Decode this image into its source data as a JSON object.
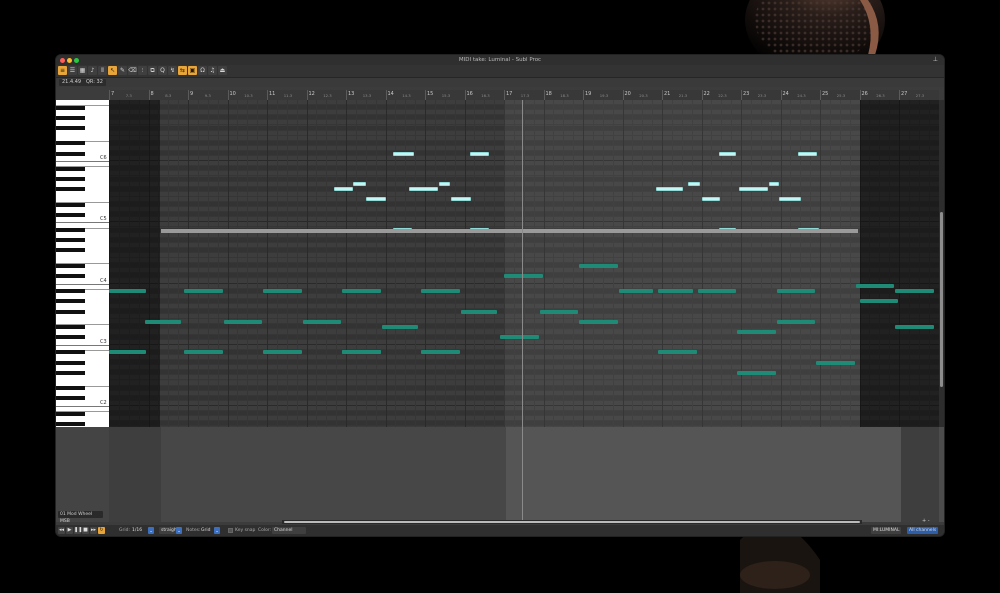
{
  "window": {
    "title": "MIDI take: Luminal - Subl Proc"
  },
  "info": {
    "position": "21.4.49",
    "grid_display": "QR: 32"
  },
  "ruler": {
    "bars": [
      {
        "bar": "7",
        "half": "7.3"
      },
      {
        "bar": "8",
        "half": "8.3"
      },
      {
        "bar": "9",
        "half": "9.3"
      },
      {
        "bar": "10",
        "half": "10.3"
      },
      {
        "bar": "11",
        "half": "11.3"
      },
      {
        "bar": "12",
        "half": "12.3"
      },
      {
        "bar": "13",
        "half": "13.3"
      },
      {
        "bar": "14",
        "half": "14.3"
      },
      {
        "bar": "15",
        "half": "15.3"
      },
      {
        "bar": "16",
        "half": "16.3"
      },
      {
        "bar": "17",
        "half": "17.3"
      },
      {
        "bar": "18",
        "half": "18.3"
      },
      {
        "bar": "19",
        "half": "19.3"
      },
      {
        "bar": "20",
        "half": "20.3"
      },
      {
        "bar": "21",
        "half": "21.3"
      },
      {
        "bar": "22",
        "half": "22.3"
      },
      {
        "bar": "23",
        "half": "23.3"
      },
      {
        "bar": "24",
        "half": "24.3"
      },
      {
        "bar": "25",
        "half": "25.3"
      },
      {
        "bar": "26",
        "half": "26.3"
      },
      {
        "bar": "27",
        "half": "27.3"
      }
    ]
  },
  "keyboard": {
    "octave_labels": [
      "C6",
      "C5",
      "C4",
      "C3",
      "C2",
      "C1"
    ]
  },
  "notes": [
    {
      "bar": 14,
      "beat": 0.2,
      "len": 0.55,
      "row": 10,
      "vel": "hi"
    },
    {
      "bar": 16,
      "beat": 0.15,
      "len": 0.5,
      "row": 10,
      "vel": "hi"
    },
    {
      "bar": 12.7,
      "beat": 0,
      "len": 0.5,
      "row": 17,
      "vel": "hi"
    },
    {
      "bar": 13.18,
      "beat": 0,
      "len": 0.35,
      "row": 16,
      "vel": "hi"
    },
    {
      "bar": 13.5,
      "beat": 0,
      "len": 0.55,
      "row": 19,
      "vel": "hi"
    },
    {
      "bar": 14.6,
      "beat": 0,
      "len": 0.75,
      "row": 17,
      "vel": "hi"
    },
    {
      "bar": 15.35,
      "beat": 0,
      "len": 0.3,
      "row": 16,
      "vel": "hi"
    },
    {
      "bar": 15.65,
      "beat": 0,
      "len": 0.55,
      "row": 19,
      "vel": "hi"
    },
    {
      "bar": 14.2,
      "beat": 0,
      "len": 0.5,
      "row": 25,
      "vel": "hi"
    },
    {
      "bar": 16.15,
      "beat": 0,
      "len": 0.5,
      "row": 25,
      "vel": "hi"
    },
    {
      "bar": 22.45,
      "beat": 0,
      "len": 0.45,
      "row": 10,
      "vel": "hi"
    },
    {
      "bar": 24.45,
      "beat": 0,
      "len": 0.5,
      "row": 10,
      "vel": "hi"
    },
    {
      "bar": 20.85,
      "beat": 0,
      "len": 0.7,
      "row": 17,
      "vel": "hi"
    },
    {
      "bar": 21.65,
      "beat": 0,
      "len": 0.35,
      "row": 16,
      "vel": "hi"
    },
    {
      "bar": 22,
      "beat": 0,
      "len": 0.5,
      "row": 19,
      "vel": "hi"
    },
    {
      "bar": 22.95,
      "beat": 0,
      "len": 0.75,
      "row": 17,
      "vel": "hi"
    },
    {
      "bar": 23.7,
      "beat": 0,
      "len": 0.3,
      "row": 16,
      "vel": "hi"
    },
    {
      "bar": 23.95,
      "beat": 0,
      "len": 0.6,
      "row": 19,
      "vel": "hi"
    },
    {
      "bar": 22.45,
      "beat": 0,
      "len": 0.45,
      "row": 25,
      "vel": "hi"
    },
    {
      "bar": 24.45,
      "beat": 0,
      "len": 0.55,
      "row": 25,
      "vel": "hi"
    },
    {
      "bar": 7,
      "beat": 0,
      "len": 0.95,
      "row": 37,
      "vel": "lo"
    },
    {
      "bar": 8.9,
      "beat": 0,
      "len": 1,
      "row": 37,
      "vel": "lo"
    },
    {
      "bar": 10.9,
      "beat": 0,
      "len": 1,
      "row": 37,
      "vel": "lo"
    },
    {
      "bar": 12.9,
      "beat": 0,
      "len": 1,
      "row": 37,
      "vel": "lo"
    },
    {
      "bar": 14.9,
      "beat": 0,
      "len": 1,
      "row": 37,
      "vel": "lo"
    },
    {
      "bar": 20.9,
      "beat": 0,
      "len": 0.9,
      "row": 37,
      "vel": "lo"
    },
    {
      "bar": 21.9,
      "beat": 0,
      "len": 1,
      "row": 37,
      "vel": "lo"
    },
    {
      "bar": 23.9,
      "beat": 0,
      "len": 1,
      "row": 37,
      "vel": "lo"
    },
    {
      "bar": 25.9,
      "beat": 0,
      "len": 1,
      "row": 36,
      "vel": "lo"
    },
    {
      "bar": 26.9,
      "beat": 0,
      "len": 1,
      "row": 37,
      "vel": "lo"
    },
    {
      "bar": 7.9,
      "beat": 0,
      "len": 0.95,
      "row": 43,
      "vel": "lo"
    },
    {
      "bar": 9.9,
      "beat": 0,
      "len": 1,
      "row": 43,
      "vel": "lo"
    },
    {
      "bar": 11.9,
      "beat": 0,
      "len": 1,
      "row": 43,
      "vel": "lo"
    },
    {
      "bar": 13.9,
      "beat": 0,
      "len": 0.95,
      "row": 44,
      "vel": "lo"
    },
    {
      "bar": 15.9,
      "beat": 0,
      "len": 0.95,
      "row": 41,
      "vel": "lo"
    },
    {
      "bar": 17.9,
      "beat": 0,
      "len": 1,
      "row": 41,
      "vel": "lo"
    },
    {
      "bar": 18.9,
      "beat": 0,
      "len": 1,
      "row": 43,
      "vel": "lo"
    },
    {
      "bar": 22.9,
      "beat": 0,
      "len": 1,
      "row": 45,
      "vel": "lo"
    },
    {
      "bar": 23.9,
      "beat": 0,
      "len": 1,
      "row": 43,
      "vel": "lo"
    },
    {
      "bar": 26,
      "beat": 0,
      "len": 1,
      "row": 39,
      "vel": "lo"
    },
    {
      "bar": 26.9,
      "beat": 0,
      "len": 1,
      "row": 44,
      "vel": "lo"
    },
    {
      "bar": 17,
      "beat": 0,
      "len": 1,
      "row": 34,
      "vel": "lo"
    },
    {
      "bar": 18.9,
      "beat": 0,
      "len": 1,
      "row": 32,
      "vel": "lo"
    },
    {
      "bar": 19.9,
      "beat": 0,
      "len": 0.9,
      "row": 37,
      "vel": "lo"
    },
    {
      "bar": 7,
      "beat": 0,
      "len": 0.95,
      "row": 49,
      "vel": "lo"
    },
    {
      "bar": 8.9,
      "beat": 0,
      "len": 1,
      "row": 49,
      "vel": "lo"
    },
    {
      "bar": 10.9,
      "beat": 0,
      "len": 1,
      "row": 49,
      "vel": "lo"
    },
    {
      "bar": 12.9,
      "beat": 0,
      "len": 1,
      "row": 49,
      "vel": "lo"
    },
    {
      "bar": 14.9,
      "beat": 0,
      "len": 1,
      "row": 49,
      "vel": "lo"
    },
    {
      "bar": 16.9,
      "beat": 0,
      "len": 1,
      "row": 46,
      "vel": "lo"
    },
    {
      "bar": 20.9,
      "beat": 0,
      "len": 1,
      "row": 49,
      "vel": "lo"
    },
    {
      "bar": 22.9,
      "beat": 0,
      "len": 1,
      "row": 53,
      "vel": "lo"
    },
    {
      "bar": 24.9,
      "beat": 0,
      "len": 1,
      "row": 51,
      "vel": "lo"
    },
    {
      "bar": 12.9,
      "beat": 0,
      "len": 1,
      "row": 49,
      "vel": "lo"
    }
  ],
  "lane": {
    "cc_selector": "01 Mod Wheel MSB"
  },
  "bottom": {
    "grid_label": "Grid:",
    "grid_value": "1/16",
    "grid_mode": "straight",
    "notes_label": "Notes:",
    "notes_value": "Grid",
    "keysnap_label": "Key snap",
    "color_label": "Color:",
    "color_value": "Channel",
    "take_name": "MI:LUMINAL",
    "channels": "All channels"
  },
  "colors": {
    "accent": "#e8a63a",
    "note_high": "#c6f5f4",
    "note_low": "#1f8b77"
  }
}
